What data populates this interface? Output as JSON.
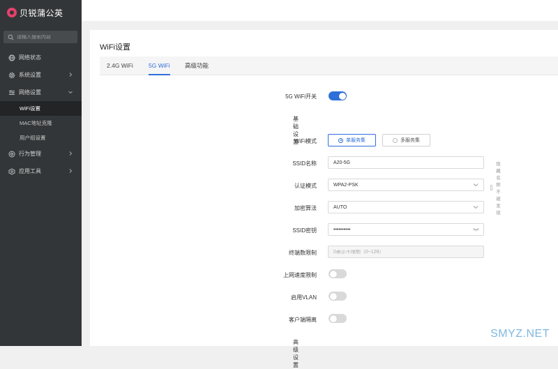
{
  "app": {
    "logo_text": "贝锐蒲公英"
  },
  "search": {
    "placeholder": "请输入搜索内容"
  },
  "sidebar": {
    "items": [
      {
        "label": "网络状态",
        "icon": "globe-icon"
      },
      {
        "label": "系统设置",
        "icon": "gear-icon"
      },
      {
        "label": "网络设置",
        "icon": "settings-sliders-icon"
      },
      {
        "label": "行为管理",
        "icon": "behavior-icon"
      },
      {
        "label": "应用工具",
        "icon": "tool-icon"
      }
    ],
    "sub_items": [
      {
        "label": "WiFi设置",
        "active": true
      },
      {
        "label": "MAC地址克隆",
        "active": false
      },
      {
        "label": "用户组设置",
        "active": false
      }
    ]
  },
  "page": {
    "title": "WiFi设置"
  },
  "tabs": [
    {
      "label": "2.4G WiFi",
      "active": false
    },
    {
      "label": "5G WiFi",
      "active": true
    },
    {
      "label": "高级功能",
      "active": false
    }
  ],
  "form": {
    "wifi_switch": {
      "label": "5G WiFi开关",
      "on": true
    },
    "basic_section": "基础设置",
    "mode": {
      "label": "WiFi模式",
      "options": [
        "单服务集",
        "多服务集"
      ],
      "selected": "单服务集"
    },
    "ssid": {
      "label": "SSID名称",
      "value": "A20-5G",
      "hide_label": "隐藏名称不被发现"
    },
    "auth": {
      "label": "认证模式",
      "value": "WPA2-PSK"
    },
    "cipher": {
      "label": "加密算法",
      "value": "AUTO"
    },
    "password": {
      "label": "SSID密钥",
      "value": "••••••••••"
    },
    "client_limit": {
      "label": "终端数限制",
      "placeholder": "0表示不限制（0~128）"
    },
    "speed_limit": {
      "label": "上网速度限制",
      "on": false
    },
    "vlan": {
      "label": "启用VLAN",
      "on": false
    },
    "isolation": {
      "label": "客户端隔离",
      "on": false
    },
    "advanced_section": "高级设置"
  },
  "watermark": "SMYZ.NET",
  "colors": {
    "accent": "#2e6fd9",
    "sidebar_bg": "#333638",
    "logo": "#e6416c"
  }
}
